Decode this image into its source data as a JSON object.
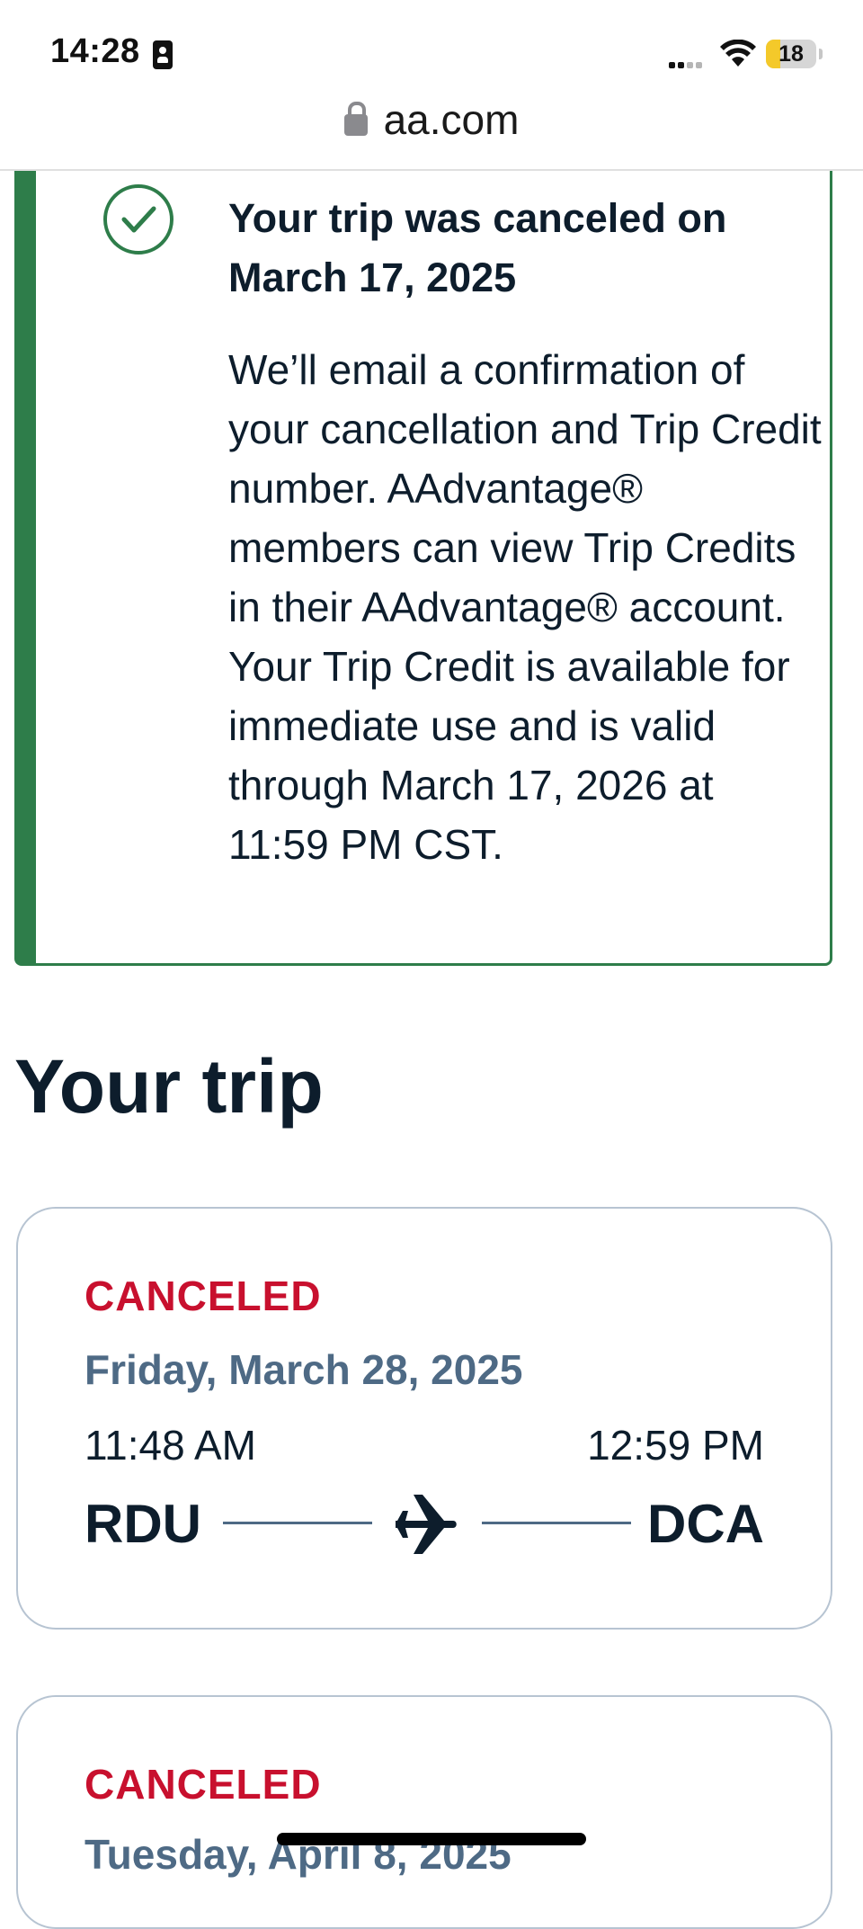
{
  "status_bar": {
    "time": "14:28",
    "battery_level": "18"
  },
  "browser": {
    "url": "aa.com"
  },
  "alert": {
    "title": "Your trip was canceled on March 17, 2025",
    "body": "We’ll email a confirmation of your cancellation and Trip Credit number. AAdvantage® members can view Trip Credits in their AAdvantage® account. Your Trip Credit is available for immediate use and is valid through March 17, 2026 at 11:59 PM CST."
  },
  "section_title": "Your trip",
  "trips": [
    {
      "status": "CANCELED",
      "date": "Friday, March 28, 2025",
      "depart_time": "11:48 AM",
      "arrive_time": "12:59 PM",
      "origin": "RDU",
      "destination": "DCA"
    },
    {
      "status": "CANCELED",
      "date": "Tuesday, April 8, 2025"
    }
  ],
  "colors": {
    "success": "#2e7d4a",
    "canceled": "#c8102e",
    "muted": "#4e6a85",
    "text": "#0d1d2c"
  },
  "icons": [
    "id-card-icon",
    "cellular-signal-icon",
    "wifi-icon",
    "battery-icon",
    "lock-icon",
    "checkmark-circle-icon",
    "airplane-icon"
  ]
}
